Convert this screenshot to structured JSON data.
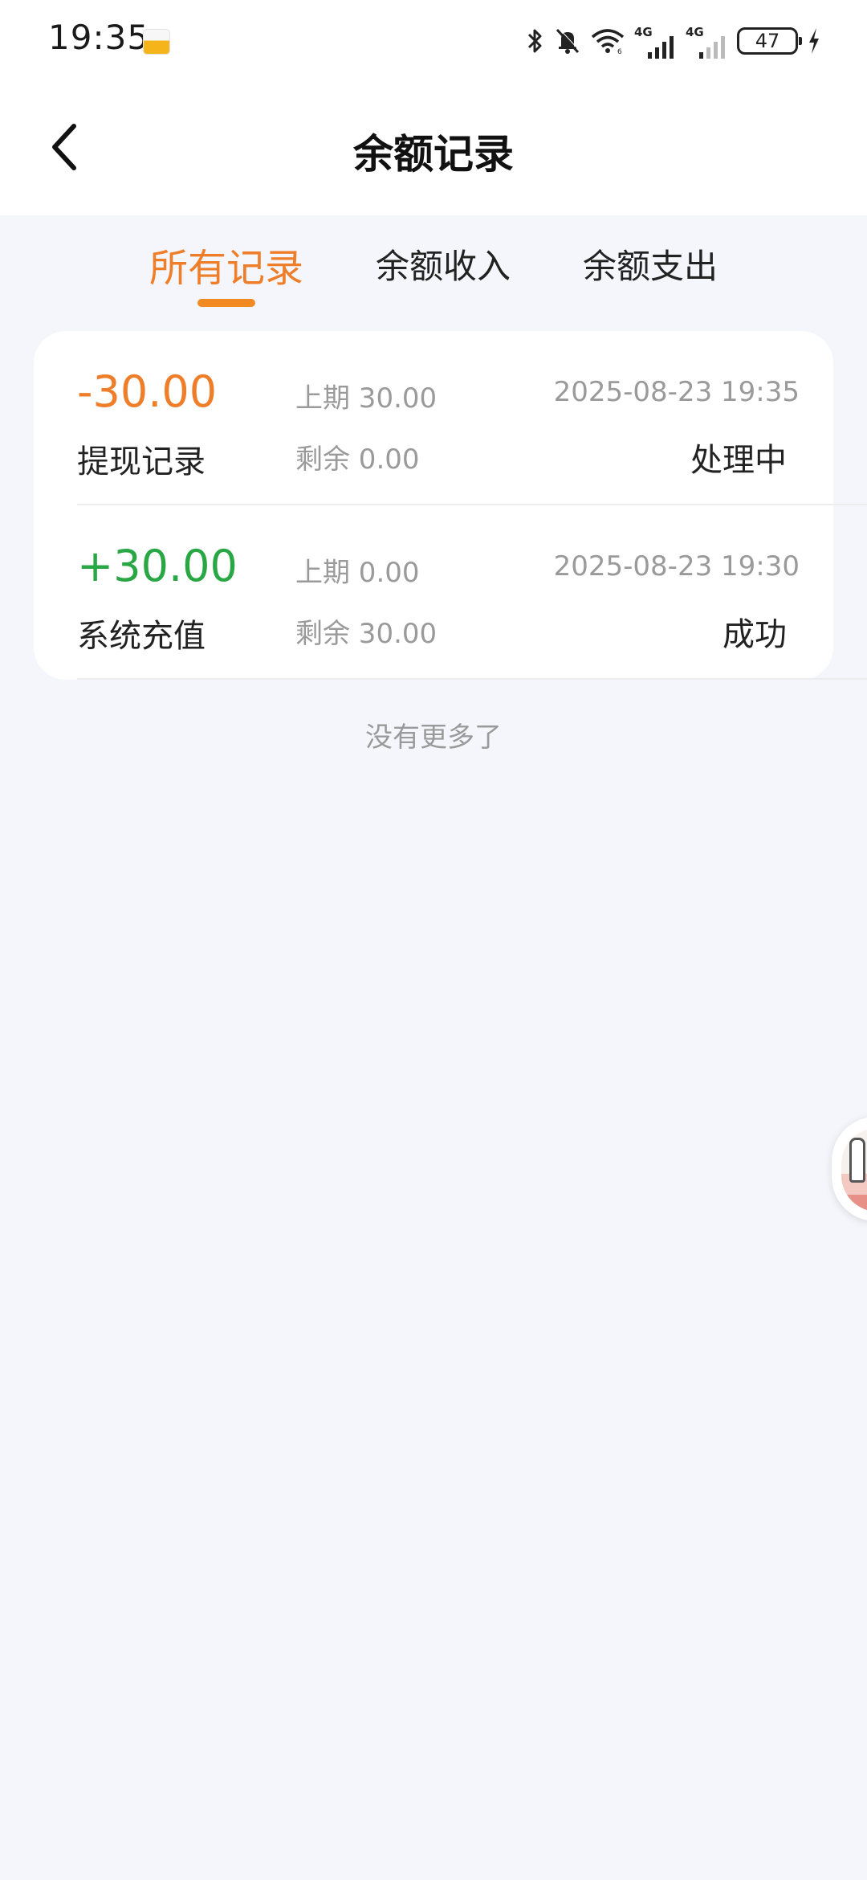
{
  "status_bar": {
    "time": "19:35",
    "network_1": "4G",
    "network_2": "4G",
    "battery": "47",
    "icons": [
      "app-badge-icon",
      "bluetooth-icon",
      "bell-muted-icon",
      "wifi-icon",
      "signal-icon",
      "signal-icon",
      "battery-icon",
      "charging-icon"
    ]
  },
  "header": {
    "title": "余额记录",
    "back_icon": "chevron-left-icon"
  },
  "tabs": [
    {
      "label": "所有记录",
      "active": true
    },
    {
      "label": "余额收入",
      "active": false
    },
    {
      "label": "余额支出",
      "active": false
    }
  ],
  "records": [
    {
      "amount": "-30.00",
      "type": "提现记录",
      "prev": "上期 30.00",
      "remain": "剩余 0.00",
      "time": "2025-08-23 19:35",
      "status": "处理中"
    },
    {
      "amount": "+30.00",
      "type": "系统充值",
      "prev": "上期 0.00",
      "remain": "剩余 30.00",
      "time": "2025-08-23 19:30",
      "status": "成功"
    }
  ],
  "list_footer": "没有更多了",
  "colors": {
    "accent": "#ee7e2a",
    "positive": "#2aa745",
    "background": "#f5f6fb"
  }
}
